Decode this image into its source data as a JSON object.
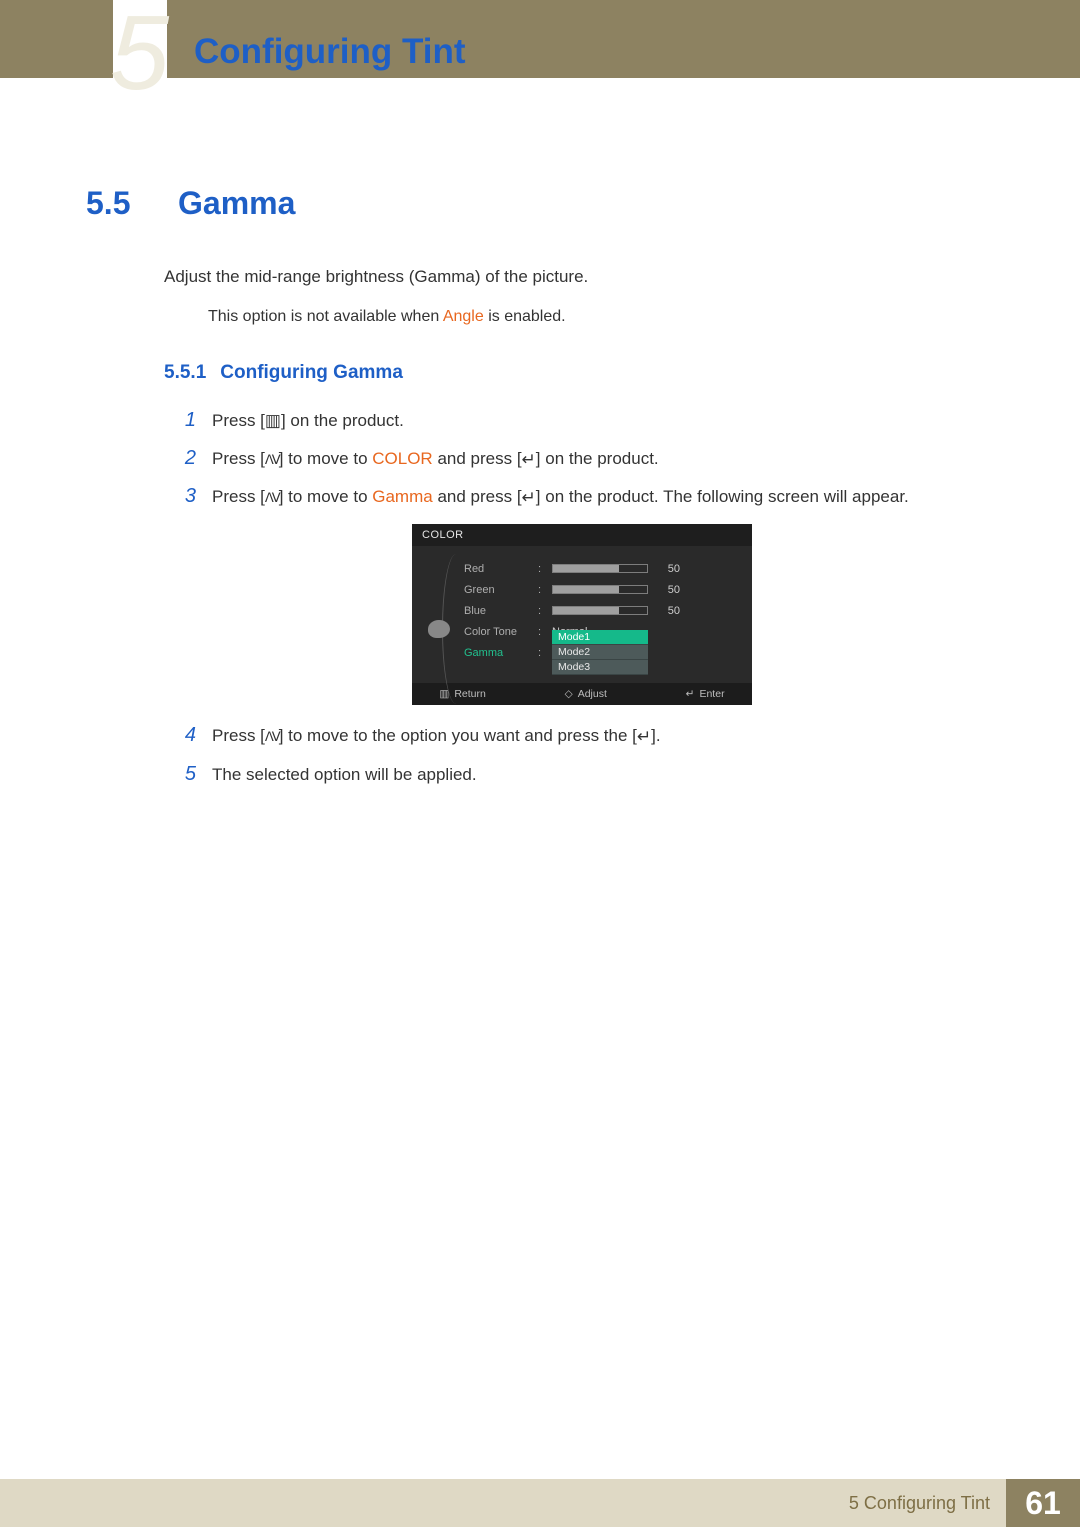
{
  "chapter": {
    "number": "5",
    "title": "Configuring Tint"
  },
  "section": {
    "number": "5.5",
    "title": "Gamma"
  },
  "intro": "Adjust the mid-range brightness (Gamma) of the picture.",
  "note_prefix": "This option is not available when ",
  "note_highlight": "Angle",
  "note_suffix": " is enabled.",
  "subsection": {
    "number": "5.5.1",
    "title": "Configuring Gamma"
  },
  "steps": {
    "s1": {
      "n": "1",
      "a": "Press [",
      "b": "] on the product."
    },
    "s2": {
      "n": "2",
      "a": "Press [",
      "b": "] to move to ",
      "hl": "COLOR",
      "c": " and press [",
      "d": "] on the product."
    },
    "s3": {
      "n": "3",
      "a": "Press [",
      "b": "] to move to ",
      "hl": "Gamma",
      "c": " and press [",
      "d": "] on the product. The following screen will appear."
    },
    "s4": {
      "n": "4",
      "a": "Press [",
      "b": "] to move to the option you want and press the [",
      "c": "]."
    },
    "s5": {
      "n": "5",
      "a": "The selected option will be applied."
    }
  },
  "osd": {
    "title": "COLOR",
    "rows": {
      "red": {
        "label": "Red",
        "value": "50",
        "fill": 70
      },
      "green": {
        "label": "Green",
        "value": "50",
        "fill": 70
      },
      "blue": {
        "label": "Blue",
        "value": "50",
        "fill": 70
      },
      "tone": {
        "label": "Color Tone",
        "value": "Normal"
      },
      "gamma": {
        "label": "Gamma"
      }
    },
    "dropdown": {
      "m1": "Mode1",
      "m2": "Mode2",
      "m3": "Mode3"
    },
    "footer": {
      "return": "Return",
      "adjust": "Adjust",
      "enter": "Enter"
    }
  },
  "footer": {
    "chapter_label": "5 Configuring Tint",
    "page": "61"
  },
  "icons": {
    "menu": "▥",
    "updown": "ᐱᐯ",
    "enter": "↵",
    "return_sym": "▥",
    "adjust_sym": "◇",
    "enter_sym": "↵"
  }
}
